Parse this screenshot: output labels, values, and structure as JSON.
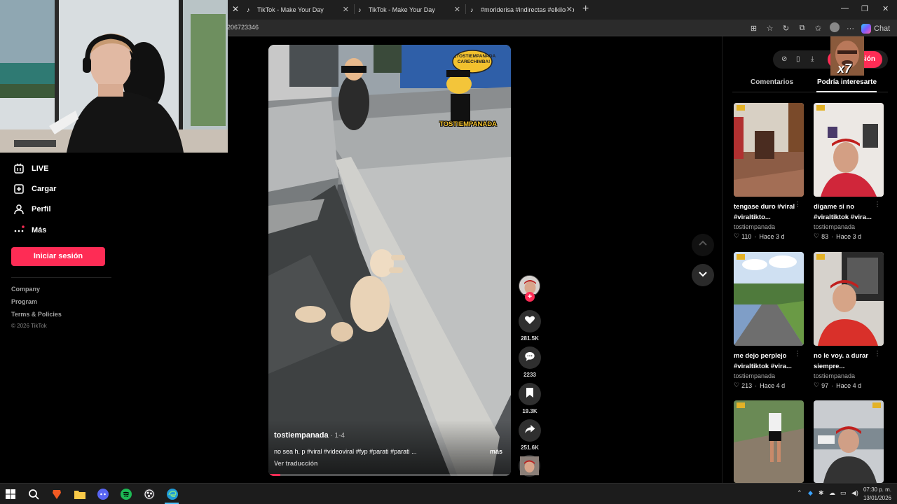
{
  "browser": {
    "tabs": [
      {
        "title": "TikTok - Make Your Day"
      },
      {
        "title": "TikTok - Make Your Day"
      },
      {
        "title": "#moriderisa #indirectas #elkilomb"
      }
    ],
    "url_fragment": "206723346",
    "chat_label": "Chat"
  },
  "sidebar": {
    "items": [
      {
        "label": "LIVE",
        "icon": "live-icon"
      },
      {
        "label": "Cargar",
        "icon": "upload-icon"
      },
      {
        "label": "Perfil",
        "icon": "profile-icon"
      },
      {
        "label": "Más",
        "icon": "more-icon"
      }
    ],
    "login_label": "Iniciar sesión",
    "footer": [
      "Company",
      "Program",
      "Terms & Policies"
    ],
    "copyright": "© 2026 TikTok"
  },
  "video": {
    "overlay_top": "¡TOSTIEMPANADA CARECHIMBA!",
    "overlay_brand": "TOSTIEMPANADA",
    "author": "tostiempanada",
    "date": " · 1-4",
    "description": "no sea h. p #viral #videoviral #fyp #parati #parati ...",
    "more": "más",
    "translate": "Ver traducción",
    "progress": 0.05
  },
  "actions": {
    "likes": "281.5K",
    "comments": "2233",
    "saves": "19.3K",
    "shares": "251.6K"
  },
  "right_panel": {
    "login_label": "Iniciar sesión",
    "overlay_badge": "x7",
    "tabs": [
      "Comentarios",
      "Podría interesarte"
    ],
    "cards": [
      {
        "title": "tengase duro #viral #viraltikto...",
        "author": "tostiempanada",
        "likes": "110",
        "age": "Hace 3 d"
      },
      {
        "title": "digame si no #viraltiktok #vira...",
        "author": "tostiempanada",
        "likes": "83",
        "age": "Hace 3 d"
      },
      {
        "title": "me dejo perplejo #viraltiktok #vira...",
        "author": "tostiempanada",
        "likes": "213",
        "age": "Hace 4 d"
      },
      {
        "title": "no le voy. a durar siempre...",
        "author": "tostiempanada",
        "likes": "97",
        "age": "Hace 4 d"
      },
      {
        "title": "",
        "author": "",
        "likes": "",
        "age": ""
      },
      {
        "title": "",
        "author": "",
        "likes": "",
        "age": ""
      }
    ]
  },
  "taskbar": {
    "time": "07:30 p. m.",
    "date": "13/01/2026"
  },
  "colors": {
    "accent": "#fe2c55",
    "background": "#000000"
  }
}
